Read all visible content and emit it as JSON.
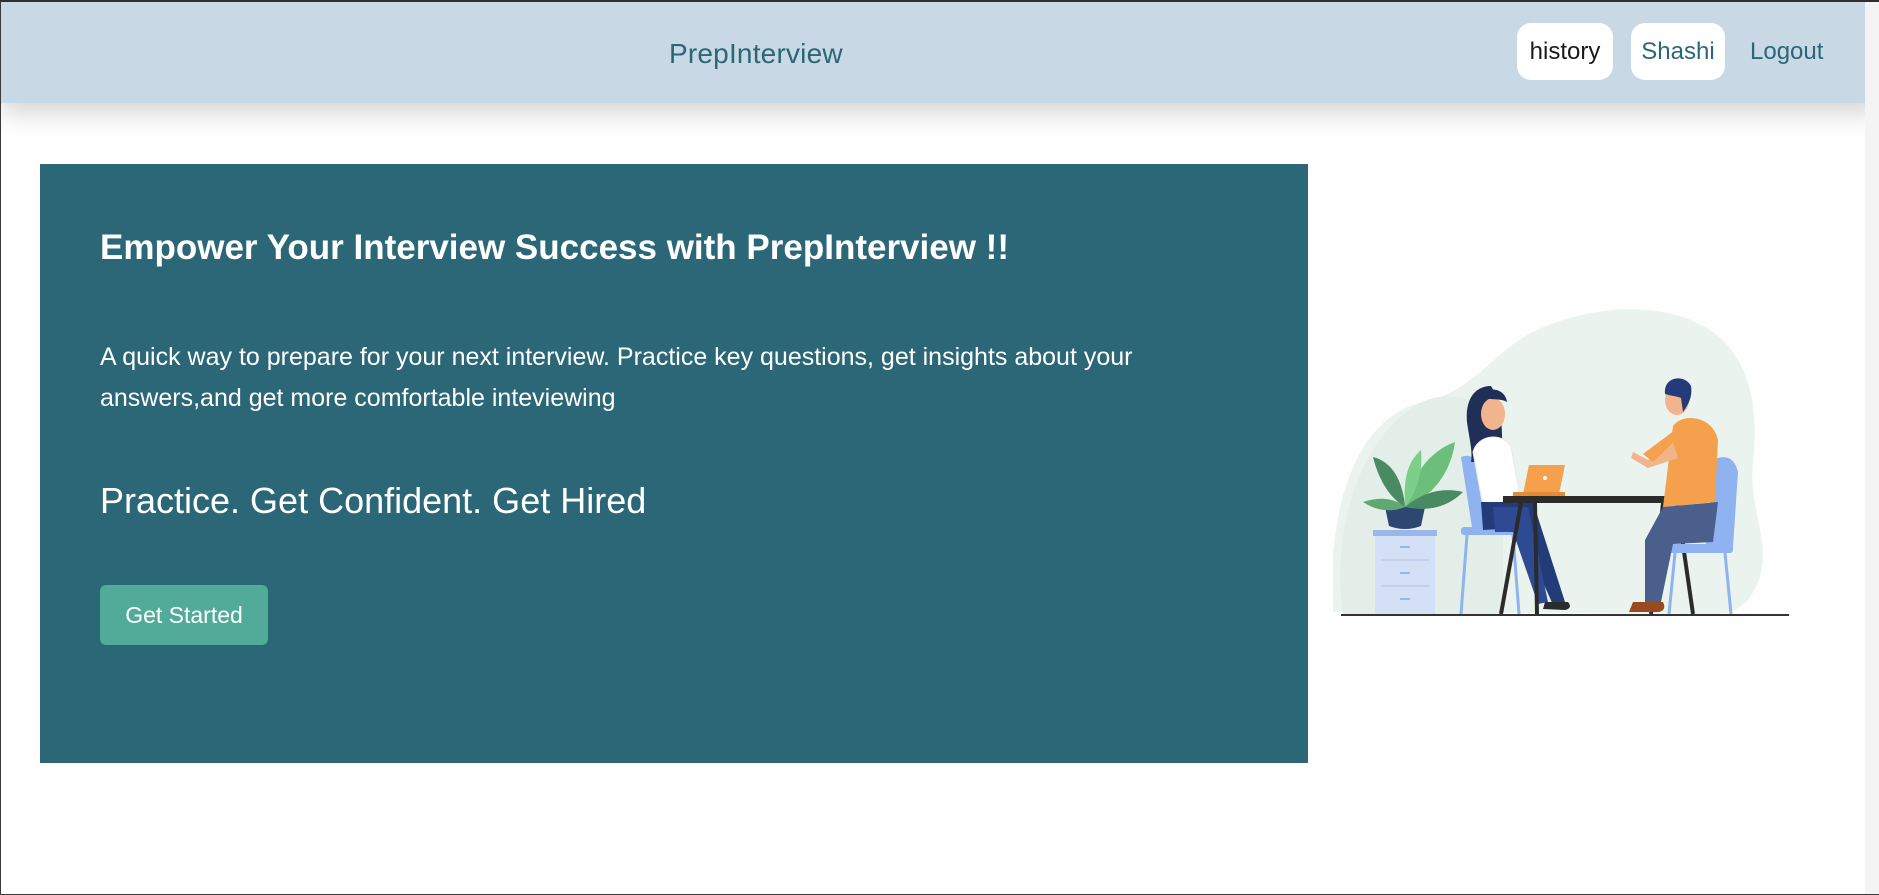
{
  "navbar": {
    "brand": "PrepInterview",
    "history_label": "history",
    "user_label": "Shashi",
    "logout_label": "Logout"
  },
  "hero": {
    "title": "Empower Your Interview Success with PrepInterview !!",
    "description": "A quick way to prepare for your next interview. Practice key questions, get insights about your answers,and get more comfortable inteviewing",
    "tagline": "Practice. Get Confident. Get Hired",
    "cta_label": "Get Started"
  },
  "illustration": {
    "icon": "interview-illustration-icon"
  },
  "colors": {
    "navbar_bg": "#c8d8e4",
    "primary": "#2b6777",
    "accent": "#52ab98",
    "white": "#ffffff"
  }
}
